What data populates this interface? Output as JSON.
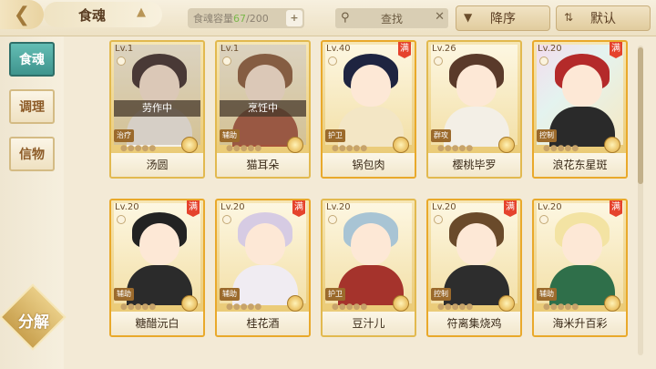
{
  "header": {
    "title": "食魂",
    "capacity_label": "食魂容量 ",
    "capacity_current": "67",
    "capacity_total": "/200",
    "capacity_add": "+",
    "search_label": "查找",
    "sort_label": "降序",
    "filter_label": "默认"
  },
  "sidebar": {
    "tabs": [
      {
        "label": "食魂",
        "active": true
      },
      {
        "label": "调理",
        "active": false
      },
      {
        "label": "信物",
        "active": false
      }
    ],
    "breakdown_label": "分解"
  },
  "cards": [
    {
      "level": "Lv.1",
      "name": "汤圆",
      "status": "劳作中",
      "role": "治疗",
      "full": false,
      "hair": "#3a2a2a",
      "outfit": "#f6f2ea"
    },
    {
      "level": "Lv.1",
      "name": "猫耳朵",
      "status": "烹饪中",
      "role": "辅助",
      "full": false,
      "hair": "#8a5a3a",
      "outfit": "#a4533b"
    },
    {
      "level": "Lv.40",
      "name": "锅包肉",
      "status": "",
      "role": "护卫",
      "full": true,
      "hair": "#1e2440",
      "outfit": "#f3e6c5"
    },
    {
      "level": "Lv.26",
      "name": "樱桃毕罗",
      "status": "",
      "role": "群攻",
      "full": false,
      "hair": "#5a3a2a",
      "outfit": "#f3efe6"
    },
    {
      "level": "Lv.20",
      "name": "浪花东星斑",
      "status": "",
      "role": "控制",
      "full": true,
      "hair": "#b42a2a",
      "outfit": "#2a2a2a"
    },
    {
      "level": "Lv.20",
      "name": "糖醋沅白",
      "status": "",
      "role": "辅助",
      "full": true,
      "hair": "#222222",
      "outfit": "#2b2b2b"
    },
    {
      "level": "Lv.20",
      "name": "桂花酒",
      "status": "",
      "role": "辅助",
      "full": true,
      "hair": "#d6cbe3",
      "outfit": "#f0ecf2"
    },
    {
      "level": "Lv.20",
      "name": "豆汁儿",
      "status": "",
      "role": "护卫",
      "full": false,
      "hair": "#a8c4d4",
      "outfit": "#a5332c"
    },
    {
      "level": "Lv.20",
      "name": "符离集烧鸡",
      "status": "",
      "role": "控制",
      "full": true,
      "hair": "#6a4a2a",
      "outfit": "#2d2d2d"
    },
    {
      "level": "Lv.20",
      "name": "海米升百彩",
      "status": "",
      "role": "辅助",
      "full": true,
      "hair": "#f3e3a3",
      "outfit": "#2f6f4a"
    }
  ]
}
